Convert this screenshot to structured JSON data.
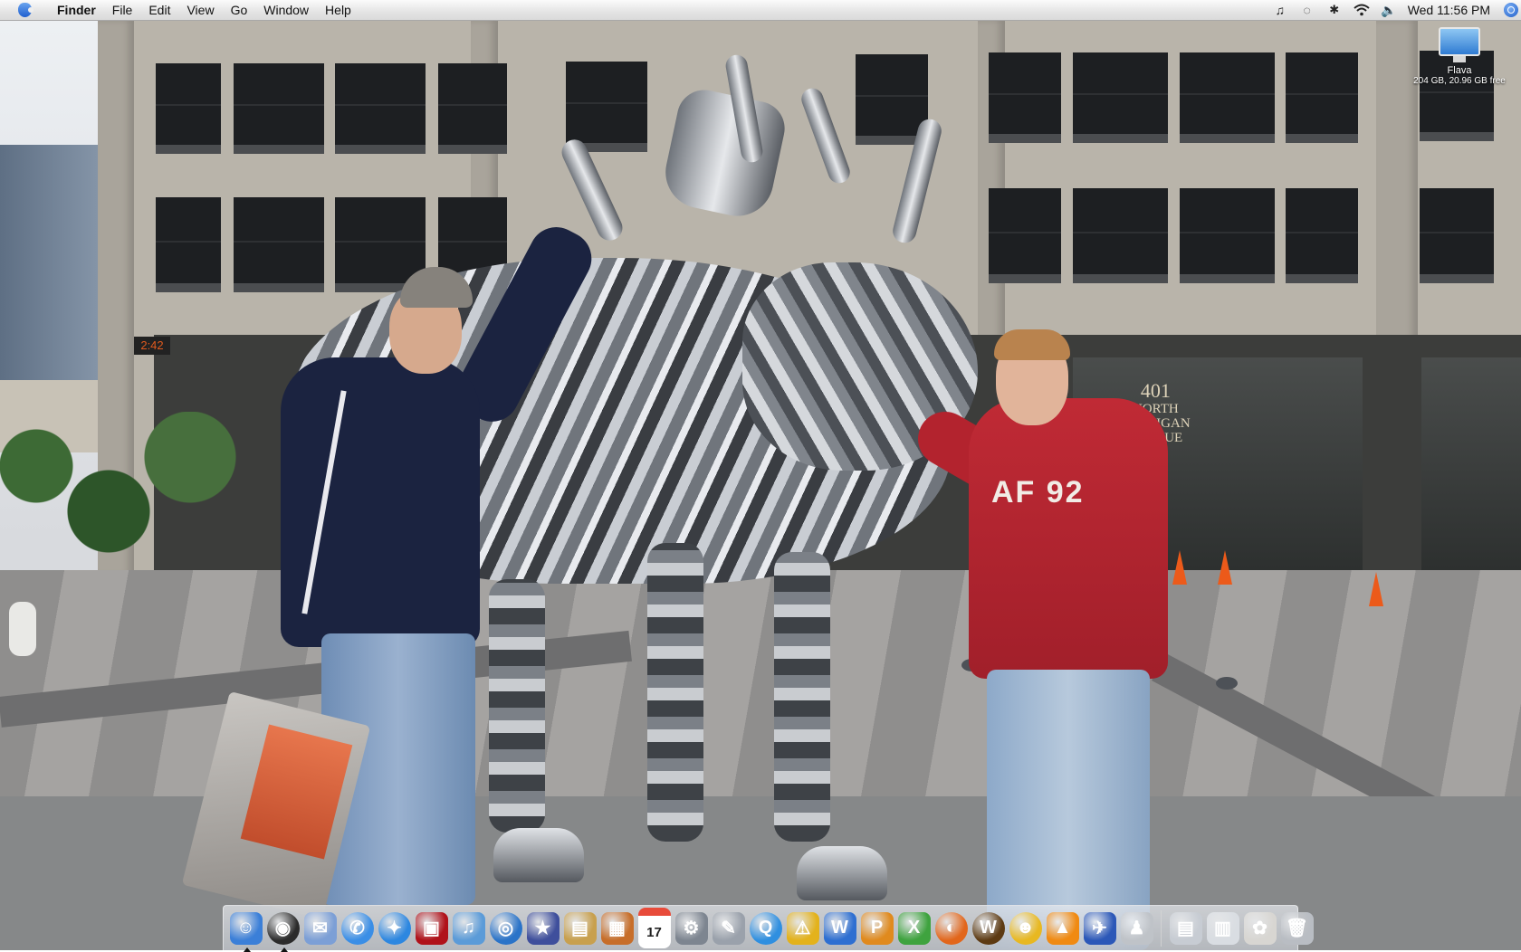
{
  "menubar": {
    "app_name": "Finder",
    "menus": [
      "File",
      "Edit",
      "View",
      "Go",
      "Window",
      "Help"
    ],
    "status_icons": [
      "itunes-note-icon",
      "sync-icon",
      "bluetooth-icon",
      "wifi-icon",
      "volume-icon"
    ],
    "clock": "Wed 11:56 PM"
  },
  "desktop": {
    "disk": {
      "name": "Flava",
      "info": "204 GB, 20.96 GB free"
    },
    "wallpaper": {
      "sign_time": "2:42",
      "address_lines": [
        "401",
        "NORTH",
        "MICHIGAN",
        "AVENUE"
      ],
      "hoodie_text": "AF 92"
    }
  },
  "dock": {
    "apps": [
      {
        "name": "finder-icon",
        "glyph": "☺",
        "color": "#3b7fd8",
        "running": true
      },
      {
        "name": "dashboard-icon",
        "glyph": "◉",
        "color": "#2b2b2b",
        "running": true
      },
      {
        "name": "mail-icon",
        "glyph": "✉",
        "color": "#7c9fd6",
        "running": false
      },
      {
        "name": "ichat-icon",
        "glyph": "✆",
        "color": "#3a8ee6",
        "running": false
      },
      {
        "name": "safari-icon",
        "glyph": "✦",
        "color": "#2d87e0",
        "running": false
      },
      {
        "name": "photo-booth-icon",
        "glyph": "▣",
        "color": "#b0121a",
        "running": false
      },
      {
        "name": "itunes-icon",
        "glyph": "♫",
        "color": "#5b9bd8",
        "running": false
      },
      {
        "name": "dvd-player-icon",
        "glyph": "◎",
        "color": "#2a73c8",
        "running": false
      },
      {
        "name": "imovie-icon",
        "glyph": "★",
        "color": "#3f4f9c",
        "running": false
      },
      {
        "name": "preview-icon",
        "glyph": "▤",
        "color": "#c8a04e",
        "running": false
      },
      {
        "name": "iphoto-icon",
        "glyph": "▦",
        "color": "#c76e2a",
        "running": false
      },
      {
        "name": "ical-icon",
        "glyph": "17",
        "color": "#e84b3a",
        "running": false
      },
      {
        "name": "system-preferences-icon",
        "glyph": "⚙",
        "color": "#7d8590",
        "running": false
      },
      {
        "name": "script-editor-icon",
        "glyph": "✎",
        "color": "#9aa1ab",
        "running": false
      },
      {
        "name": "quicktime-icon",
        "glyph": "Q",
        "color": "#2f8fe0",
        "running": false
      },
      {
        "name": "console-warning-icon",
        "glyph": "⚠",
        "color": "#e3b21c",
        "running": false
      },
      {
        "name": "microsoft-word-icon",
        "glyph": "W",
        "color": "#2e6fd1",
        "running": false
      },
      {
        "name": "microsoft-powerpoint-icon",
        "glyph": "P",
        "color": "#e08a1e",
        "running": false
      },
      {
        "name": "microsoft-excel-icon",
        "glyph": "X",
        "color": "#3fa33f",
        "running": false
      },
      {
        "name": "firefox-icon",
        "glyph": "◐",
        "color": "#e2661b",
        "running": false
      },
      {
        "name": "world-of-warcraft-icon",
        "glyph": "W",
        "color": "#5d3a12",
        "running": false
      },
      {
        "name": "aim-icon",
        "glyph": "☻",
        "color": "#e8b821",
        "running": false
      },
      {
        "name": "vlc-icon",
        "glyph": "▲",
        "color": "#f08a12",
        "running": false
      },
      {
        "name": "cyberduck-icon",
        "glyph": "✈",
        "color": "#2c58b8",
        "running": false
      },
      {
        "name": "game-figure-icon",
        "glyph": "♟",
        "color": "#bfc3c8",
        "running": false
      }
    ],
    "docs": [
      {
        "name": "documents-stack-icon",
        "glyph": "▤",
        "color": "#c7ccd3"
      },
      {
        "name": "downloads-stack-icon",
        "glyph": "▥",
        "color": "#d9dde2"
      },
      {
        "name": "koala-photo-icon",
        "glyph": "✿",
        "color": "#d8d6d2"
      },
      {
        "name": "trash-icon",
        "glyph": "🗑",
        "color": "#b9bdc3"
      }
    ]
  }
}
